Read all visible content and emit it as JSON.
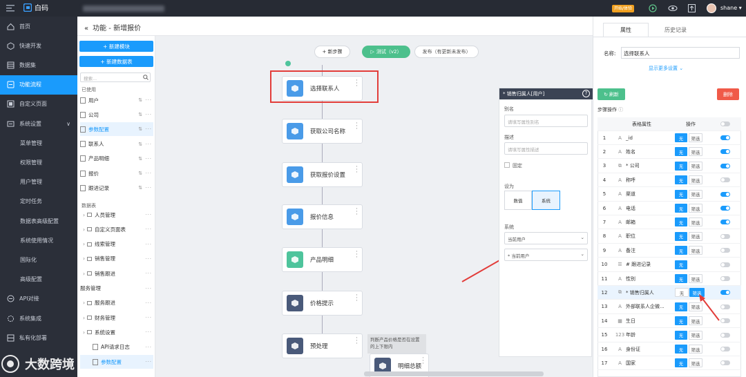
{
  "topbar": {
    "brand": "白码",
    "user": "shane",
    "trial_badge": "开始/体验",
    "menu_icon": "menu-icon",
    "user_caret": "▾"
  },
  "sidebar": {
    "items": [
      {
        "label": "首页",
        "icon": "home-icon"
      },
      {
        "label": "快速开发",
        "icon": "cube-icon"
      },
      {
        "label": "数据集",
        "icon": "table-icon"
      },
      {
        "label": "功能流程",
        "icon": "flow-icon",
        "active": true
      },
      {
        "label": "自定义页面",
        "icon": "page-icon"
      },
      {
        "label": "系统设置",
        "icon": "settings-icon",
        "caret": "∨"
      },
      {
        "label": "菜单管理",
        "sub": true
      },
      {
        "label": "权限管理",
        "sub": true
      },
      {
        "label": "用户管理",
        "sub": true
      },
      {
        "label": "定时任务",
        "sub": true
      },
      {
        "label": "数据表高级配置",
        "sub": true
      },
      {
        "label": "系统使用情况",
        "sub": true
      },
      {
        "label": "国际化",
        "sub": true
      },
      {
        "label": "高级配置",
        "sub": true
      },
      {
        "label": "API对接",
        "icon": "api-icon"
      },
      {
        "label": "系统集成",
        "icon": "integration-icon"
      },
      {
        "label": "私有化部署",
        "icon": "server-icon"
      }
    ]
  },
  "panel2": {
    "new_module": "+ 新建模块",
    "new_table": "+ 新建数据表",
    "search_placeholder": "搜索...",
    "used_label": "已使用",
    "used": [
      "用户",
      "公司",
      "参数配置",
      "联系人",
      "产品明细",
      "报价",
      "跟进记录"
    ],
    "tables_label": "数据表",
    "tree": [
      "人员管理",
      "自定义页面表",
      "线索管理",
      "销售管理",
      "销售跟进"
    ],
    "service_label": "服务管理",
    "tree2": [
      "服务跟进",
      "财务管理",
      "系统设置"
    ],
    "leaf": [
      "API请求日志",
      "参数配置"
    ]
  },
  "main": {
    "title": "功能 - 新增报价",
    "new_step": "+ 新步骤",
    "test": "测试（v2）",
    "publish": "发布（有更新未发布）",
    "nodes": [
      {
        "label": "选择联系人",
        "color": "#4a9be8"
      },
      {
        "label": "获取公司名称",
        "color": "#4a9be8"
      },
      {
        "label": "获取报价设置",
        "color": "#4a9be8"
      },
      {
        "label": "报价信息",
        "color": "#4a9be8"
      },
      {
        "label": "产品明细",
        "color": "#4ec49c"
      },
      {
        "label": "价格提示",
        "color": "#4a5a7a"
      },
      {
        "label": "预处理",
        "color": "#4a5a7a"
      },
      {
        "label": "明细总额",
        "color": "#4a5a7a"
      }
    ],
    "note": "判断产品价格是否在设置的上下限内"
  },
  "prop": {
    "header": "* 销售归属人[用户]",
    "help": "?",
    "alias_label": "别名",
    "alias_placeholder": "请填写属性别名",
    "desc_label": "描述",
    "desc_placeholder": "请填写属性描述",
    "fixed_label": "固定",
    "setas_label": "设为",
    "opt_value": "数值",
    "opt_system": "系统",
    "system_label": "系统",
    "select1": "当前用户",
    "select2": "* 当前用户"
  },
  "right": {
    "tab_props": "属性",
    "tab_history": "历史记录",
    "name_label": "名称:",
    "name_value": "选择联系人",
    "more": "显示更多设置",
    "refresh": "刷新",
    "delete": "删除",
    "step_ops": "步骤操作",
    "col_attr": "表格属性",
    "col_op": "操作",
    "none": "无",
    "filter": "筛选",
    "rows": [
      {
        "n": "1",
        "name": "_id",
        "icon": "A",
        "toggle": true,
        "filter": true
      },
      {
        "n": "2",
        "name": "姓名",
        "icon": "A",
        "toggle": true,
        "filter": true
      },
      {
        "n": "3",
        "name": "* 公司",
        "icon": "⧉",
        "toggle": true,
        "filter": true
      },
      {
        "n": "4",
        "name": "称呼",
        "icon": "A",
        "toggle": false,
        "filter": true
      },
      {
        "n": "5",
        "name": "渠道",
        "icon": "A",
        "toggle": true,
        "filter": true
      },
      {
        "n": "6",
        "name": "电话",
        "icon": "A",
        "toggle": true,
        "filter": true
      },
      {
        "n": "7",
        "name": "邮箱",
        "icon": "A",
        "toggle": true,
        "filter": true
      },
      {
        "n": "8",
        "name": "职位",
        "icon": "A",
        "toggle": false,
        "filter": true
      },
      {
        "n": "9",
        "name": "备注",
        "icon": "A",
        "toggle": false,
        "filter": true
      },
      {
        "n": "10",
        "name": "# 跟进记录",
        "icon": "☰",
        "toggle": false,
        "filter": false
      },
      {
        "n": "11",
        "name": "性别",
        "icon": "A",
        "toggle": false,
        "filter": true
      },
      {
        "n": "12",
        "name": "* 销售归属人",
        "icon": "⧉",
        "toggle": true,
        "filter": true,
        "highlight": true
      },
      {
        "n": "13",
        "name": "外部联系人企微...",
        "icon": "A",
        "toggle": false,
        "filter": true
      },
      {
        "n": "14",
        "name": "生日",
        "icon": "▦",
        "toggle": false,
        "filter": true
      },
      {
        "n": "15",
        "name": "年龄",
        "icon": "123",
        "toggle": false,
        "filter": true
      },
      {
        "n": "16",
        "name": "身份证",
        "icon": "A",
        "toggle": false,
        "filter": true
      },
      {
        "n": "17",
        "name": "国家",
        "icon": "A",
        "toggle": false,
        "filter": true
      }
    ]
  },
  "watermark": "大数跨境"
}
